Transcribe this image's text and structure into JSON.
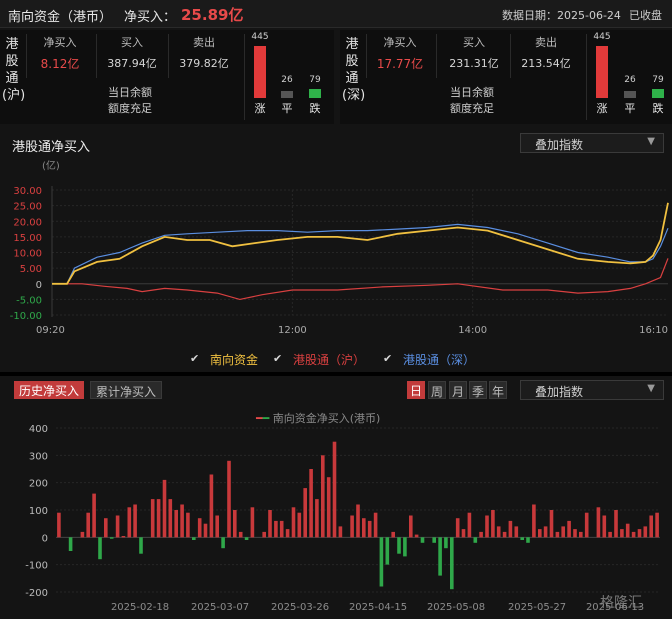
{
  "header": {
    "title": "南向资金（港币）",
    "net_label": "净买入：",
    "net_value": "25.89亿",
    "date_text": "数据日期：2025-06-24",
    "state_text": "已收盘"
  },
  "panels": [
    {
      "label": "港股通(沪)",
      "net_buy_label": "净买入",
      "net_buy_value": "8.12亿",
      "buy_label": "买入",
      "buy_value": "387.94亿",
      "sell_label": "卖出",
      "sell_value": "379.82亿",
      "balance_label": "当日余额",
      "balance_value": "额度充足",
      "up_count": "445",
      "flat_count": "26",
      "down_count": "79",
      "up_label": "涨",
      "flat_label": "平",
      "down_label": "跌"
    },
    {
      "label": "港股通(深)",
      "net_buy_label": "净买入",
      "net_buy_value": "17.77亿",
      "buy_label": "买入",
      "buy_value": "231.31亿",
      "sell_label": "卖出",
      "sell_value": "213.54亿",
      "balance_label": "当日余额",
      "balance_value": "额度充足",
      "up_count": "445",
      "flat_count": "26",
      "down_count": "79",
      "up_label": "涨",
      "flat_label": "平",
      "down_label": "跌"
    }
  ],
  "intraday": {
    "title": "港股通净买入",
    "overlay_label": "叠加指数",
    "legend": [
      {
        "label": "南向资金",
        "color": "#f0c040"
      },
      {
        "label": "港股通（沪）",
        "color": "#d94040"
      },
      {
        "label": "港股通（深）",
        "color": "#5a8ee0"
      }
    ]
  },
  "history": {
    "tabs": [
      "历史净买入",
      "累计净买入"
    ],
    "periods": [
      "日",
      "周",
      "月",
      "季",
      "年"
    ],
    "overlay_label": "叠加指数",
    "legend_label": "南向资金净买入(港币)"
  },
  "watermark": "格隆汇",
  "chart_data": [
    {
      "type": "line",
      "title": "港股通净买入",
      "ylabel": "(亿)",
      "ylim": [
        -10,
        30
      ],
      "yticks": [
        "30.00",
        "25.00",
        "20.00",
        "15.00",
        "10.00",
        "5.00",
        "0",
        "-5.00",
        "-10.00"
      ],
      "xlim": [
        "09:20",
        "16:10"
      ],
      "xticks": [
        "09:20",
        "12:00",
        "14:00",
        "16:10"
      ],
      "series": [
        {
          "name": "南向资金",
          "color": "#f0c040",
          "points": [
            [
              "09:20",
              0
            ],
            [
              "09:30",
              0
            ],
            [
              "09:35",
              4
            ],
            [
              "09:50",
              7
            ],
            [
              "10:05",
              8
            ],
            [
              "10:20",
              12
            ],
            [
              "10:35",
              15
            ],
            [
              "10:50",
              14
            ],
            [
              "11:05",
              14
            ],
            [
              "11:20",
              12
            ],
            [
              "11:35",
              13
            ],
            [
              "11:50",
              14
            ],
            [
              "12:10",
              15
            ],
            [
              "12:30",
              15
            ],
            [
              "12:50",
              14
            ],
            [
              "13:10",
              16
            ],
            [
              "13:30",
              17
            ],
            [
              "13:50",
              18
            ],
            [
              "14:10",
              17
            ],
            [
              "14:30",
              14
            ],
            [
              "14:50",
              11
            ],
            [
              "15:10",
              8
            ],
            [
              "15:30",
              7
            ],
            [
              "15:45",
              6.5
            ],
            [
              "15:55",
              7
            ],
            [
              "16:00",
              9
            ],
            [
              "16:05",
              14
            ],
            [
              "16:10",
              25.89
            ]
          ]
        },
        {
          "name": "港股通（沪）",
          "color": "#d94040",
          "points": [
            [
              "09:20",
              0
            ],
            [
              "09:30",
              0
            ],
            [
              "09:40",
              0
            ],
            [
              "09:55",
              -0.8
            ],
            [
              "10:10",
              -1.5
            ],
            [
              "10:20",
              -2.5
            ],
            [
              "10:35",
              -1.5
            ],
            [
              "10:50",
              -2
            ],
            [
              "11:10",
              -3
            ],
            [
              "11:25",
              -5
            ],
            [
              "11:40",
              -3.5
            ],
            [
              "12:00",
              -2
            ],
            [
              "12:30",
              -2
            ],
            [
              "13:00",
              -1
            ],
            [
              "13:30",
              -0.5
            ],
            [
              "13:50",
              0
            ],
            [
              "14:20",
              -2
            ],
            [
              "14:50",
              -2
            ],
            [
              "15:10",
              -3
            ],
            [
              "15:30",
              -2.5
            ],
            [
              "15:45",
              -1.5
            ],
            [
              "15:55",
              0
            ],
            [
              "16:05",
              2
            ],
            [
              "16:10",
              8.12
            ]
          ]
        },
        {
          "name": "港股通（深）",
          "color": "#5a8ee0",
          "points": [
            [
              "09:20",
              0
            ],
            [
              "09:30",
              0
            ],
            [
              "09:35",
              5
            ],
            [
              "09:50",
              8.5
            ],
            [
              "10:05",
              10
            ],
            [
              "10:20",
              13
            ],
            [
              "10:35",
              15.5
            ],
            [
              "10:50",
              16
            ],
            [
              "11:10",
              16.5
            ],
            [
              "11:30",
              17
            ],
            [
              "11:50",
              17
            ],
            [
              "12:10",
              16.5
            ],
            [
              "12:30",
              17
            ],
            [
              "12:50",
              17
            ],
            [
              "13:10",
              17.5
            ],
            [
              "13:30",
              18
            ],
            [
              "13:50",
              19
            ],
            [
              "14:10",
              18
            ],
            [
              "14:30",
              16
            ],
            [
              "14:50",
              13
            ],
            [
              "15:10",
              10
            ],
            [
              "15:30",
              8.5
            ],
            [
              "15:45",
              7
            ],
            [
              "15:55",
              7
            ],
            [
              "16:00",
              8
            ],
            [
              "16:05",
              12
            ],
            [
              "16:10",
              17.77
            ]
          ]
        }
      ]
    },
    {
      "type": "bar",
      "title": "南向资金净买入(港币)",
      "ylim": [
        -200,
        400
      ],
      "yticks": [
        "400",
        "300",
        "200",
        "100",
        "0",
        "-100",
        "-200"
      ],
      "xticks": [
        "2025-02-18",
        "2025-03-07",
        "2025-03-26",
        "2025-04-15",
        "2025-05-08",
        "2025-05-27",
        "2025-06-13"
      ],
      "values": [
        90,
        0,
        -50,
        0,
        20,
        90,
        160,
        -80,
        70,
        -5,
        80,
        5,
        110,
        120,
        -60,
        0,
        140,
        140,
        210,
        140,
        100,
        120,
        90,
        -10,
        70,
        50,
        230,
        80,
        -40,
        280,
        100,
        20,
        -10,
        110,
        0,
        20,
        100,
        60,
        60,
        30,
        110,
        90,
        180,
        250,
        140,
        300,
        220,
        350,
        40,
        0,
        80,
        120,
        70,
        60,
        90,
        -180,
        -100,
        20,
        -60,
        -70,
        80,
        10,
        -20,
        0,
        -20,
        -140,
        -40,
        -190,
        70,
        30,
        90,
        -20,
        20,
        80,
        100,
        40,
        20,
        60,
        40,
        -10,
        -20,
        120,
        30,
        40,
        100,
        20,
        40,
        60,
        30,
        20,
        90,
        0,
        110,
        80,
        20,
        100,
        30,
        50,
        20,
        30,
        40,
        80,
        90
      ]
    }
  ]
}
